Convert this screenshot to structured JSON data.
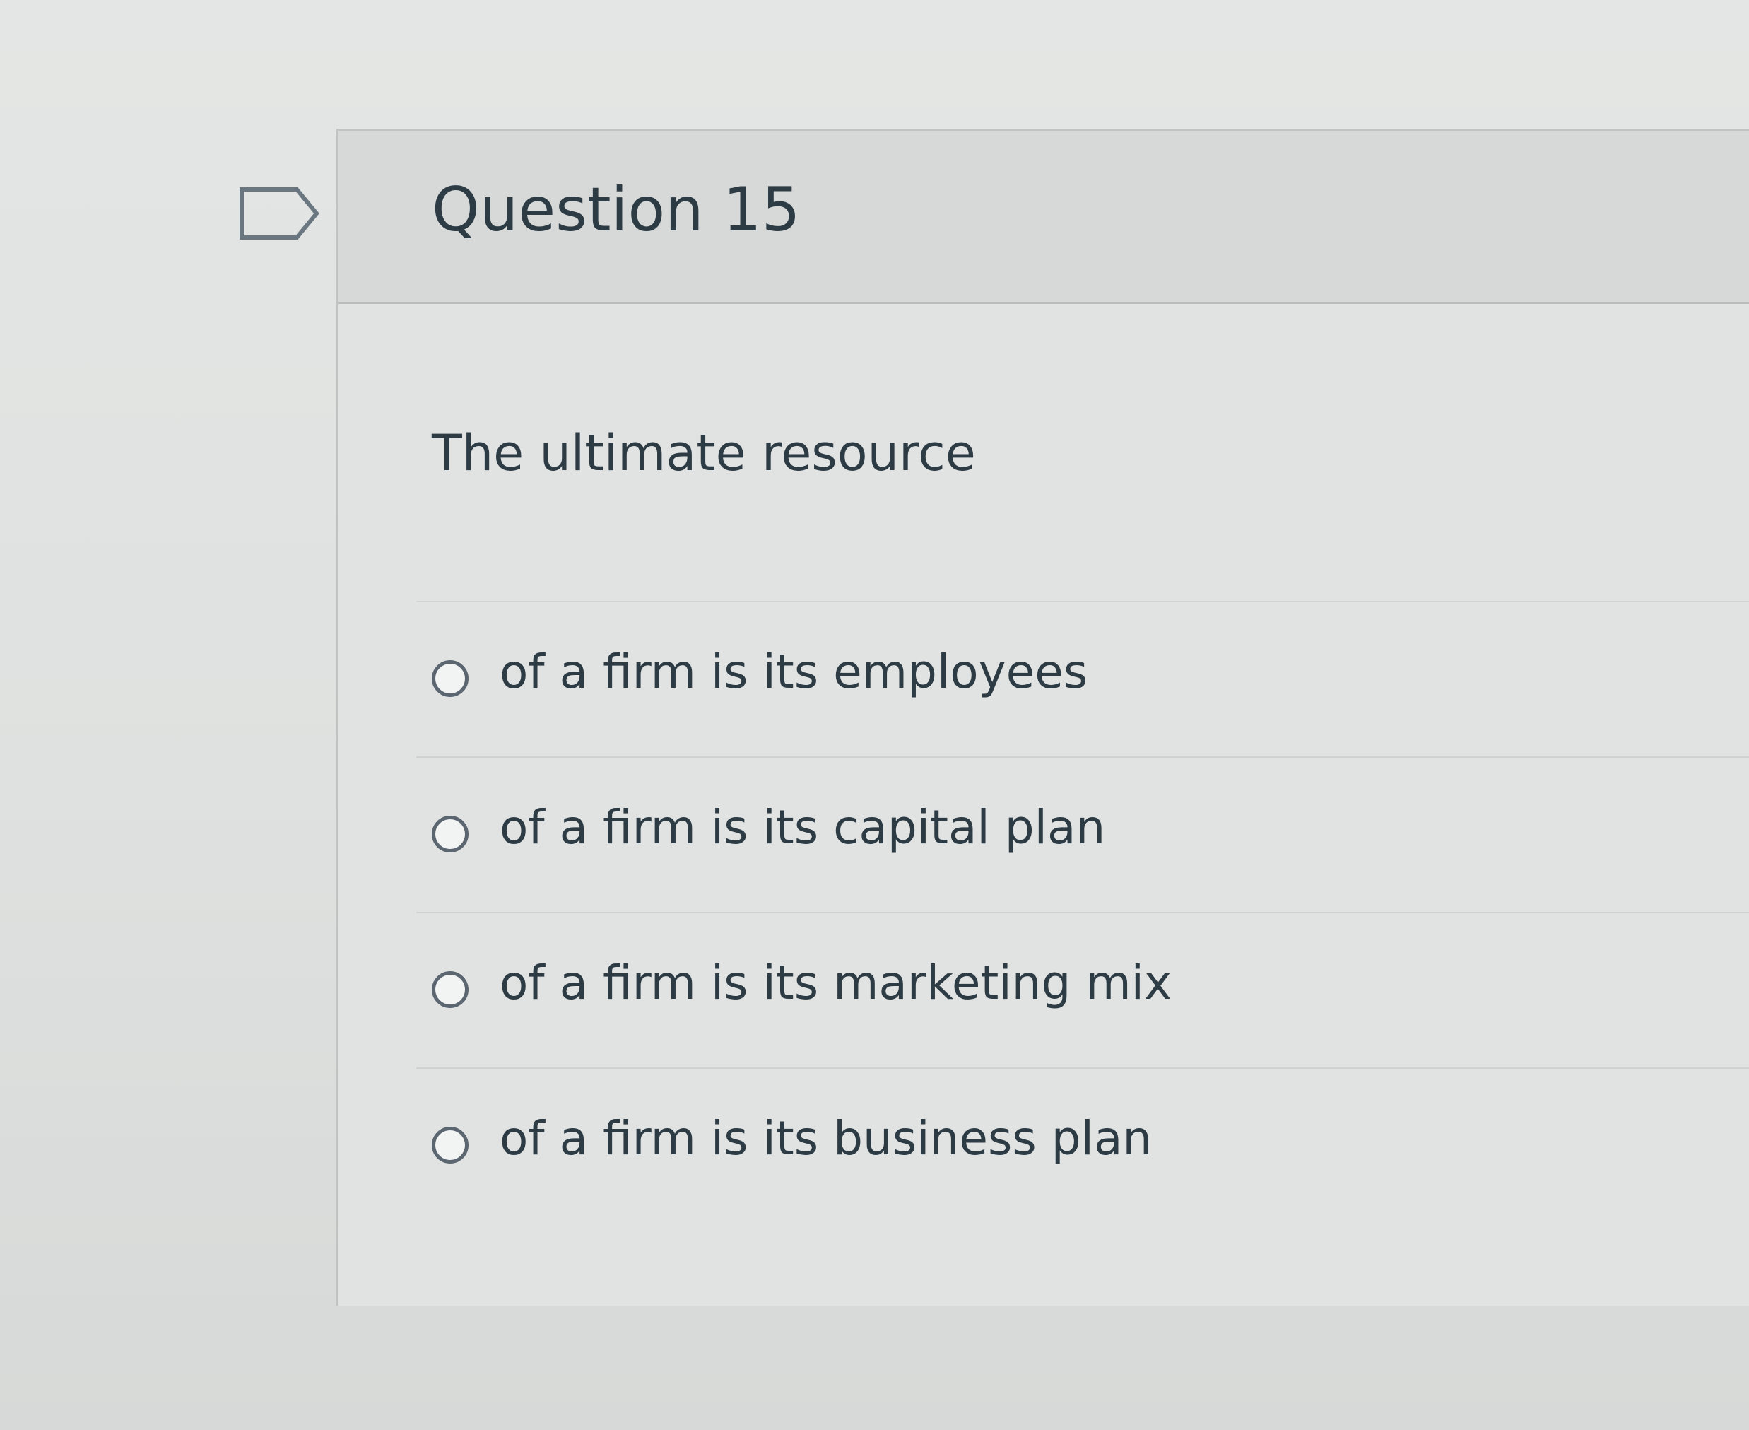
{
  "question": {
    "title": "Question 15",
    "text": "The ultimate resource",
    "flag_icon": "bookmark-flag-icon"
  },
  "answers": [
    {
      "label": "of a firm is its employees",
      "selected": false
    },
    {
      "label": "of a firm is its capital plan",
      "selected": false
    },
    {
      "label": "of a firm is its marketing mix",
      "selected": false
    },
    {
      "label": "of a firm is its business plan",
      "selected": false
    }
  ],
  "colors": {
    "text": "#2d3b45",
    "header_bg": "#d6d9d8",
    "border": "#bfc3c1"
  }
}
